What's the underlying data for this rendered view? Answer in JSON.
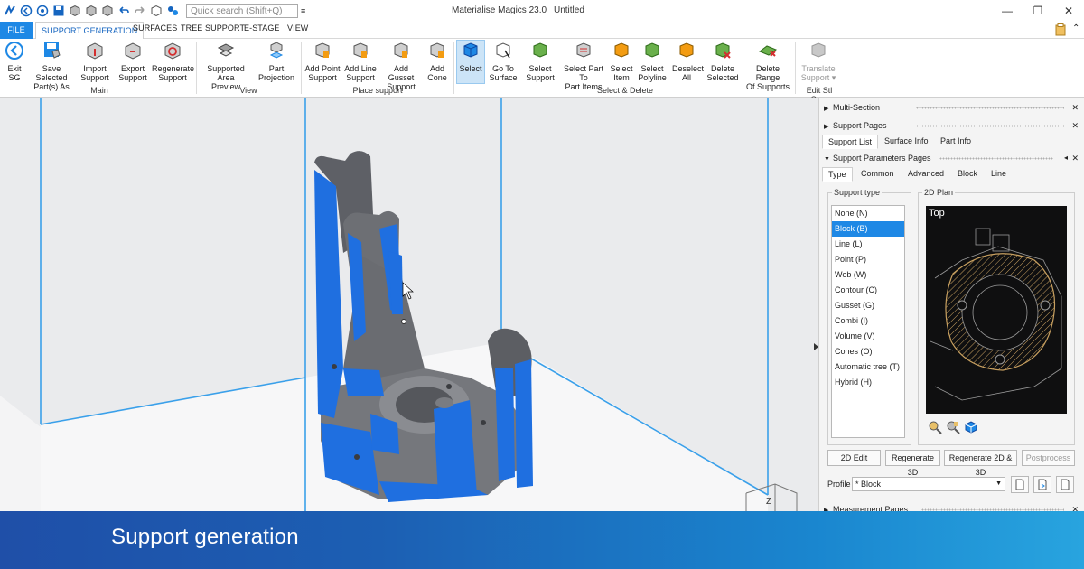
{
  "titlebar": {
    "search_placeholder": "Quick search (Shift+Q)",
    "app_title": "Materialise Magics 23.0",
    "doc_title": "Untitled",
    "minimize": "—",
    "restore": "❐",
    "close": "✕"
  },
  "tabs": {
    "file": "FILE",
    "support_generation": "SUPPORT GENERATION",
    "surfaces": "SURFACES",
    "tree_support": "TREE SUPPORT",
    "estage": "E-STAGE",
    "view": "VIEW"
  },
  "ribbon": {
    "buttons": [
      {
        "l1": "Exit",
        "l2": "SG"
      },
      {
        "l1": "Save Selected",
        "l2": "Part(s) As"
      },
      {
        "l1": "Import",
        "l2": "Support"
      },
      {
        "l1": "Export",
        "l2": "Support"
      },
      {
        "l1": "Regenerate",
        "l2": "Support"
      },
      {
        "l1": "Supported Area",
        "l2": "Preview"
      },
      {
        "l1": "Part",
        "l2": "Projection"
      },
      {
        "l1": "Add Point",
        "l2": "Support"
      },
      {
        "l1": "Add Line",
        "l2": "Support"
      },
      {
        "l1": "Add Gusset",
        "l2": "Support"
      },
      {
        "l1": "Add",
        "l2": "Cone"
      },
      {
        "l1": "Select",
        "l2": ""
      },
      {
        "l1": "Go To",
        "l2": "Surface"
      },
      {
        "l1": "Select",
        "l2": "Support"
      },
      {
        "l1": "Select Part To",
        "l2": "Part Items"
      },
      {
        "l1": "Select",
        "l2": "Item"
      },
      {
        "l1": "Select",
        "l2": "Polyline"
      },
      {
        "l1": "Deselect",
        "l2": "All"
      },
      {
        "l1": "Delete",
        "l2": "Selected"
      },
      {
        "l1": "Delete Range",
        "l2": "Of Supports"
      },
      {
        "l1": "Translate",
        "l2": "Support ▾"
      }
    ],
    "groups": {
      "main": "Main",
      "view": "View",
      "place": "Place support",
      "select": "Select & Delete",
      "edit": "Edit Stl Su..."
    }
  },
  "panel": {
    "multi_section": "Multi-Section",
    "support_pages": "Support Pages",
    "subtabs": [
      "Support List",
      "Surface Info",
      "Part Info"
    ],
    "params_pages": "Support Parameters Pages",
    "param_tabs": [
      "Type",
      "Common",
      "Advanced",
      "Block",
      "Line"
    ],
    "support_type_label": "Support type",
    "plan_label": "2D Plan",
    "plan_view": "Top",
    "support_types": [
      "None (N)",
      "Block (B)",
      "Line (L)",
      "Point (P)",
      "Web (W)",
      "Contour (C)",
      "Gusset (G)",
      "Combi (I)",
      "Volume (V)",
      "Cones (O)",
      "Automatic tree (T)",
      "Hybrid (H)"
    ],
    "selected_type_index": 1,
    "btn_2d_edit": "2D Edit",
    "btn_regen_3d": "Regenerate 3D",
    "btn_regen_2d3d": "Regenerate 2D & 3D",
    "btn_postprocess": "Postprocess",
    "profile_label": "Profile",
    "profile_value": "* Block",
    "measurement_pages": "Measurement Pages"
  },
  "viewport": {
    "axis_label": "Z"
  },
  "banner": {
    "text": "Support generation"
  },
  "colors": {
    "accent": "#1e88e5",
    "support_blue": "#1f6fe0",
    "part_gray": "#6c6e73",
    "plan_gold": "#c8a060"
  }
}
